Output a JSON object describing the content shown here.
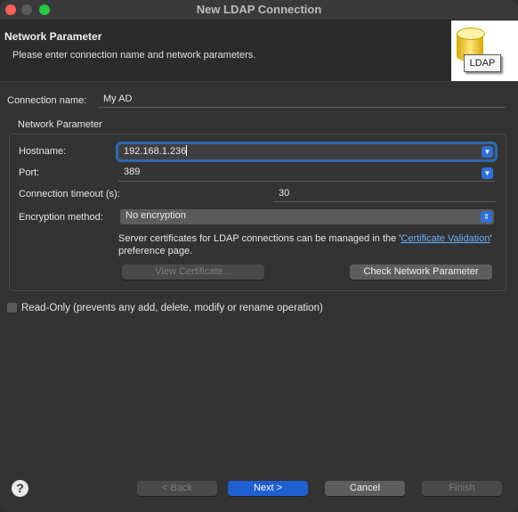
{
  "window": {
    "title": "New LDAP Connection",
    "controls": {
      "close": "close",
      "minimize": "minimize",
      "maximize": "maximize"
    }
  },
  "header": {
    "title": "Network Parameter",
    "description": "Please enter connection name and network parameters.",
    "banner_label": "LDAP",
    "banner_icon": "ldap-database-icon"
  },
  "connection": {
    "name_label": "Connection name:",
    "name_value": "My AD"
  },
  "network": {
    "group_label": "Network Parameter",
    "hostname_label": "Hostname:",
    "hostname_value": "192.168.1.236",
    "port_label": "Port:",
    "port_value": "389",
    "timeout_label": "Connection timeout (s):",
    "timeout_value": "30",
    "encryption_label": "Encryption method:",
    "encryption_value": "No encryption",
    "info_prefix": "Server certificates for LDAP connections can be managed in the '",
    "info_link": "Certificate Validation",
    "info_suffix": "' preference page.",
    "view_cert_button": "View Certificate...",
    "check_button": "Check Network Parameter"
  },
  "readonly": {
    "label": "Read-Only (prevents any add, delete, modify or rename operation)",
    "checked": false
  },
  "footer": {
    "help_icon": "help-icon",
    "back_button": "< Back",
    "next_button": "Next >",
    "cancel_button": "Cancel",
    "finish_button": "Finish"
  },
  "colors": {
    "accent": "#1f5fd0",
    "focus_ring": "#2c6ab0",
    "link": "#6ab0ff"
  }
}
